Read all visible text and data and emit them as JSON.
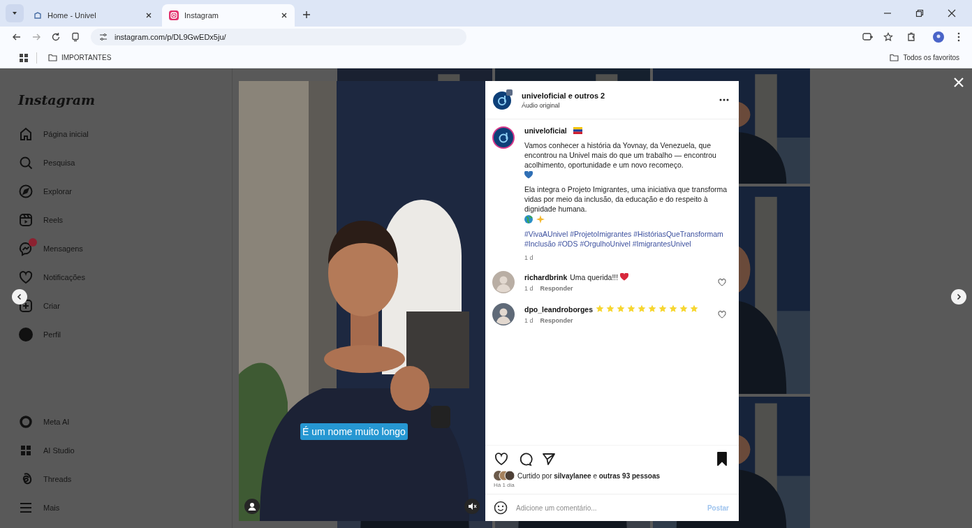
{
  "browser": {
    "tabs": [
      {
        "title": "Home - Univel",
        "selected": false
      },
      {
        "title": "Instagram",
        "selected": true
      }
    ],
    "url": "instagram.com/p/DL9GwEDx5ju/",
    "bookmark": "IMPORTANTES",
    "all_bookmarks": "Todos os favoritos"
  },
  "sidebar": {
    "logo": "Instagram",
    "items": [
      {
        "label": "Página inicial",
        "badge": false
      },
      {
        "label": "Pesquisa",
        "badge": false
      },
      {
        "label": "Explorar",
        "badge": false
      },
      {
        "label": "Reels",
        "badge": false
      },
      {
        "label": "Mensagens",
        "badge": true
      },
      {
        "label": "Notificações",
        "badge": false
      },
      {
        "label": "Criar",
        "badge": false
      },
      {
        "label": "Perfil",
        "badge": false
      }
    ],
    "bottom_items": [
      {
        "label": "Meta AI"
      },
      {
        "label": "AI Studio"
      },
      {
        "label": "Threads"
      },
      {
        "label": "Mais"
      }
    ]
  },
  "post": {
    "video": {
      "subtitle": "É um nome muito longo"
    },
    "header": {
      "author": "univeloficial e outros 2",
      "audio": "Áudio original"
    },
    "caption": {
      "username": "univeloficial",
      "paragraphs": [
        {
          "text": "Vamos conhecer a história da Yovnay, da Venezuela, que encontrou na Univel mais do que um trabalho — encontrou acolhimento, oportunidade e um novo recomeço."
        },
        {
          "text": "Ela integra o Projeto Imigrantes, uma iniciativa que transforma vidas por meio da inclusão, da educação e do respeito à dignidade humana."
        }
      ],
      "hashtags": "#VivaAUnivel #ProjetoImigrantes #HistóriasQueTransformam #Inclusão #ODS #OrgulhoUnivel #ImigrantesUnivel",
      "time": "1 d"
    },
    "comments": [
      {
        "username": "richardbrink",
        "text": "Uma querida!!!",
        "time": "1 d",
        "reply": "Responder"
      },
      {
        "username": "dpo_leandroborges",
        "time": "1 d",
        "reply": "Responder"
      }
    ],
    "saved": true,
    "likes": "Curtido por **silvaylanee** e **outras 93 pessoas**",
    "date": "Há 1 dia",
    "comment_field": {
      "placeholder": "Adicione um comentário..."
    },
    "post_button": "Postar"
  }
}
